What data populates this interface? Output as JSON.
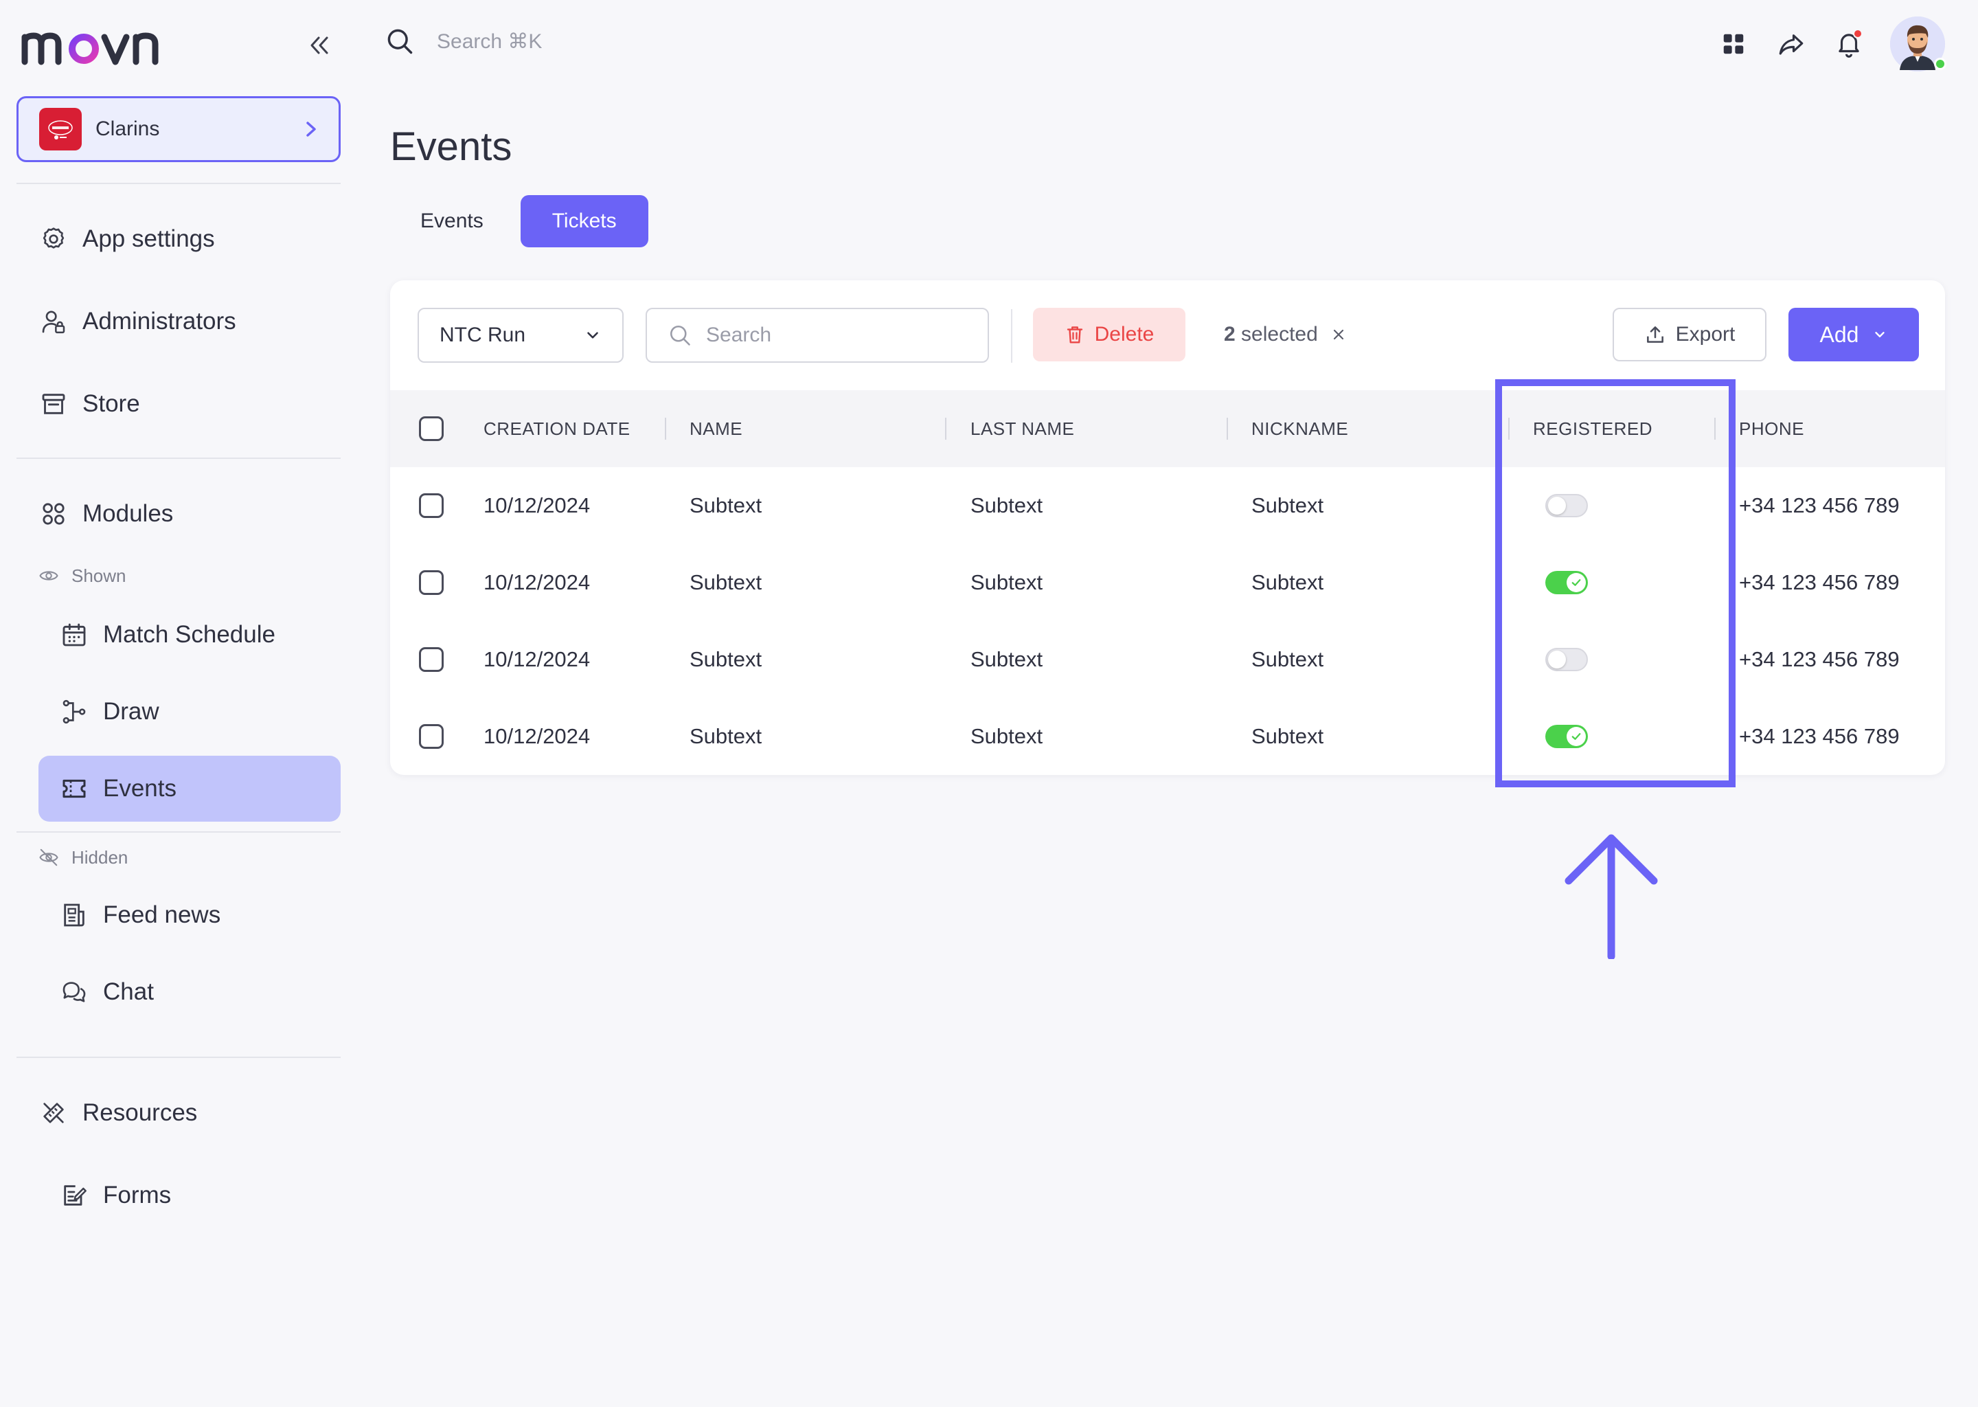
{
  "app": {
    "logo_text": "movn"
  },
  "org": {
    "name": "Clarins"
  },
  "sidebar": {
    "items": [
      {
        "label": "App settings",
        "icon": "gear-icon"
      },
      {
        "label": "Administrators",
        "icon": "admin-user-icon"
      },
      {
        "label": "Store",
        "icon": "store-icon"
      },
      {
        "label": "Modules",
        "icon": "modules-icon"
      }
    ],
    "shown_label": "Shown",
    "shown_items": [
      {
        "label": "Match Schedule",
        "icon": "calendar-icon"
      },
      {
        "label": "Draw",
        "icon": "bracket-icon"
      },
      {
        "label": "Events",
        "icon": "ticket-icon",
        "active": true
      }
    ],
    "hidden_label": "Hidden",
    "hidden_items": [
      {
        "label": "Feed news",
        "icon": "newspaper-icon"
      },
      {
        "label": "Chat",
        "icon": "chat-icon"
      }
    ],
    "bottom_items": [
      {
        "label": "Resources",
        "icon": "resources-icon"
      },
      {
        "label": "Forms",
        "icon": "form-icon"
      }
    ]
  },
  "topbar": {
    "search_placeholder": "Search ⌘K"
  },
  "page": {
    "title": "Events",
    "tabs": [
      {
        "label": "Events",
        "active": false
      },
      {
        "label": "Tickets",
        "active": true
      }
    ]
  },
  "toolbar": {
    "event_select": "NTC Run",
    "search_placeholder": "Search",
    "delete_label": "Delete",
    "selected_count": "2",
    "selected_text": "selected",
    "export_label": "Export",
    "add_label": "Add"
  },
  "table": {
    "columns": [
      "CREATION DATE",
      "NAME",
      "LAST NAME",
      "NICKNAME",
      "REGISTERED",
      "PHONE"
    ],
    "rows": [
      {
        "date": "10/12/2024",
        "name": "Subtext",
        "last_name": "Subtext",
        "nickname": "Subtext",
        "registered": false,
        "phone": "+34 123 456 789"
      },
      {
        "date": "10/12/2024",
        "name": "Subtext",
        "last_name": "Subtext",
        "nickname": "Subtext",
        "registered": true,
        "phone": "+34 123 456 789"
      },
      {
        "date": "10/12/2024",
        "name": "Subtext",
        "last_name": "Subtext",
        "nickname": "Subtext",
        "registered": false,
        "phone": "+34 123 456 789"
      },
      {
        "date": "10/12/2024",
        "name": "Subtext",
        "last_name": "Subtext",
        "nickname": "Subtext",
        "registered": true,
        "phone": "+34 123 456 789"
      }
    ]
  },
  "colors": {
    "accent": "#6b63f6",
    "active_nav": "#c1c4fb",
    "toggle_on": "#4bd14b",
    "danger": "#ea4545",
    "danger_bg": "#fde2e2"
  }
}
